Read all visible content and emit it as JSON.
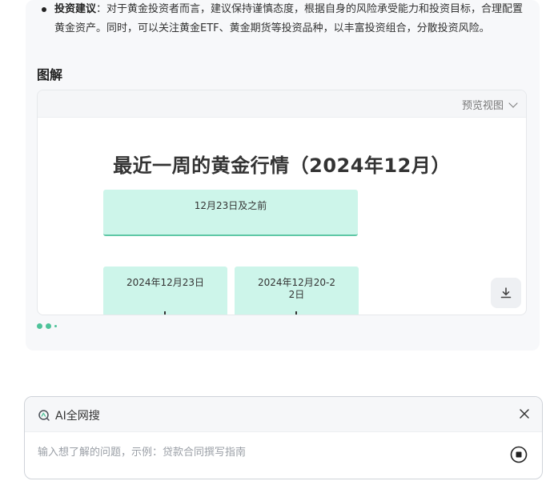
{
  "answer": {
    "bullet_label": "投资建议",
    "bullet_text": "：对于黄金投资者而言，建议保持谨慎态度，根据自身的风险承受能力和投资目标，合理配置黄金资产。同时，可以关注黄金ETF、黄金期货等投资品种，以丰富投资组合，分散投资风险。",
    "section_title": "图解"
  },
  "diagram": {
    "view_toggle": "预览视图",
    "title": "最近一周的黄金行情（2024年12月）",
    "nodes": {
      "top": "12月23日及之前",
      "left": "2024年12月23日",
      "right_line1": "2024年12月20-2",
      "right_line2": "2日"
    },
    "download_icon": "download-icon"
  },
  "search": {
    "title": "AI全网搜",
    "placeholder": "输入想了解的问题，示例：贷款合同撰写指南"
  },
  "colors": {
    "accent": "#4fc39a",
    "node_fill": "#cdf5ea"
  }
}
